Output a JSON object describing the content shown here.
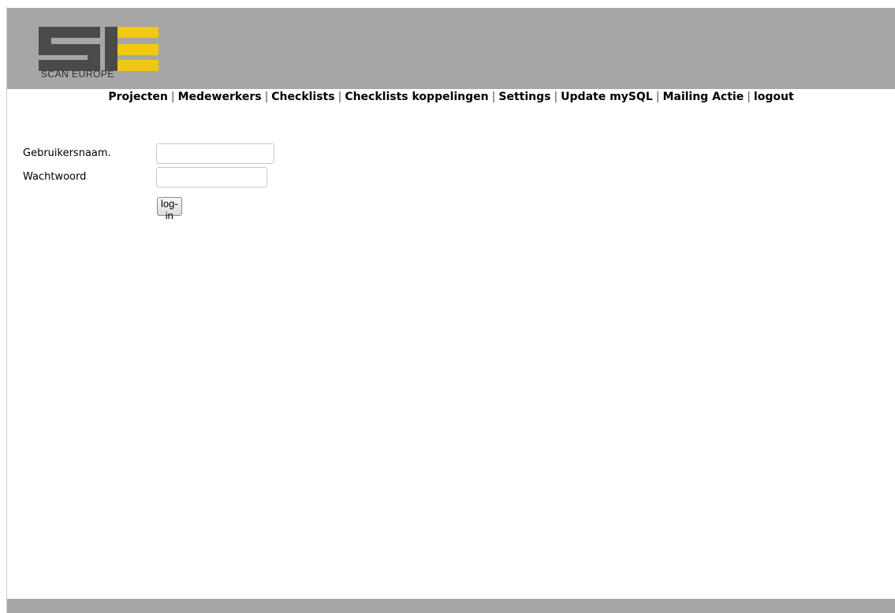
{
  "logo": {
    "text": "SCAN EUROPE",
    "colors": {
      "dark": "#4a4a4a",
      "yellow": "#f2c811"
    }
  },
  "nav": {
    "items": [
      {
        "label": "Projecten"
      },
      {
        "label": "Medewerkers"
      },
      {
        "label": "Checklists"
      },
      {
        "label": "Checklists koppelingen"
      },
      {
        "label": "Settings"
      },
      {
        "label": "Update mySQL"
      },
      {
        "label": "Mailing Actie"
      },
      {
        "label": "logout"
      }
    ],
    "separator": "|"
  },
  "login": {
    "username_label": "Gebruikersnaam.",
    "username_value": "",
    "password_label": "Wachtwoord",
    "password_value": "",
    "submit_label": "log-in"
  },
  "colors": {
    "header_bg": "#a6a6a6",
    "page_bg": "#ffffff"
  }
}
